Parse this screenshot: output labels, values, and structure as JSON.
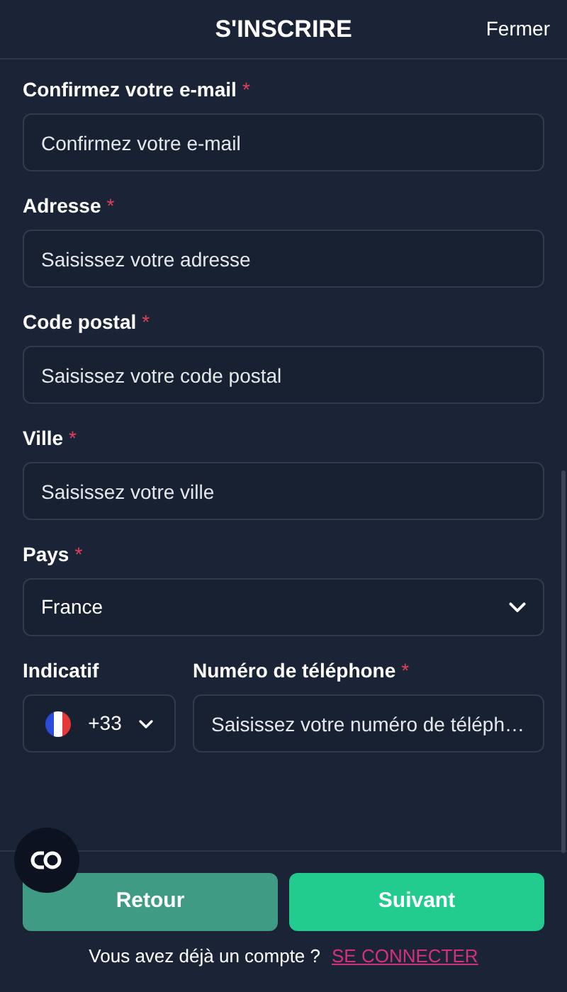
{
  "header": {
    "title": "S'INSCRIRE",
    "close": "Fermer"
  },
  "fields": [
    {
      "kind": "text",
      "label": "Confirmez votre e-mail",
      "required_mark": "*",
      "placeholder": "Confirmez votre e-mail"
    },
    {
      "kind": "text",
      "label": "Adresse",
      "required_mark": "*",
      "placeholder": "Saisissez votre adresse"
    },
    {
      "kind": "text",
      "label": "Code postal",
      "required_mark": "*",
      "placeholder": "Saisissez votre code postal"
    },
    {
      "kind": "text",
      "label": "Ville",
      "required_mark": "*",
      "placeholder": "Saisissez votre ville"
    },
    {
      "kind": "select",
      "label": "Pays",
      "required_mark": "*",
      "value": "France"
    }
  ],
  "phone": {
    "code_label": "Indicatif",
    "code": "+33",
    "number_label": "Numéro de téléphone",
    "required_mark": "*",
    "placeholder": "Saisissez votre numéro de téléph…"
  },
  "buttons": [
    {
      "label": "Retour",
      "kind": "secondary"
    },
    {
      "label": "Suivant",
      "kind": "primary"
    }
  ],
  "footer": {
    "text": "Vous avez déjà un compte ?",
    "link": "SE CONNECTER"
  }
}
